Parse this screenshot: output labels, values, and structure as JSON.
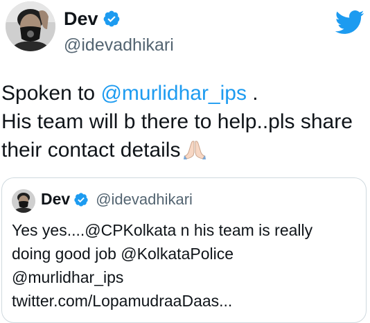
{
  "tweet": {
    "display_name": "Dev",
    "handle": "@idevadhikari",
    "verified_icon": "verified-badge-icon",
    "platform_icon": "twitter-bird-icon",
    "text": {
      "line1_prefix": "Spoken to ",
      "line1_mention": "@murlidhar_ips",
      "line1_suffix": " .",
      "line2": "His team will b there to help..pls share",
      "line3": "their contact details",
      "emoji": "folded-hands-emoji"
    }
  },
  "quoted_tweet": {
    "display_name": "Dev",
    "handle": "@idevadhikari",
    "verified_icon": "verified-badge-icon",
    "lines": [
      "Yes yes....@CPKolkata n his team is really",
      "doing good job @KolkataPolice",
      "@murlidhar_ips",
      "twitter.com/LopamudraaDaas..."
    ]
  },
  "colors": {
    "accent": "#1d9bf0",
    "text": "#0f1419",
    "secondary": "#536471",
    "border": "#cfd9de"
  }
}
